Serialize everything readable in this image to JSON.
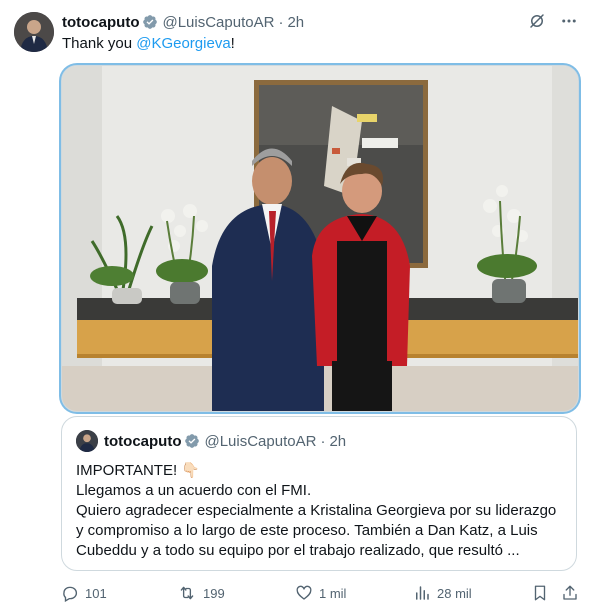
{
  "tweet": {
    "display_name": "totocaputo",
    "handle": "@LuisCaputoAR",
    "separator": "·",
    "time": "2h",
    "text_prefix": "Thank you ",
    "mention": "@KGeorgieva",
    "text_suffix": "!"
  },
  "quoted_tweet": {
    "display_name": "totocaputo",
    "handle": "@LuisCaputoAR",
    "separator": "·",
    "time": "2h",
    "lines": [
      "IMPORTANTE! 👇🏻",
      "Llegamos a un acuerdo con el FMI.",
      "Quiero agradecer especialmente a Kristalina Georgieva por su liderazgo",
      "y compromiso a lo largo de este proceso. También a Dan Katz, a Luis",
      "Cubeddu y a todo su equipo por el trabajo realizado, que resultó ..."
    ]
  },
  "actions": {
    "replies": "101",
    "reposts": "199",
    "likes": "1 mil",
    "views": "28 mil"
  },
  "colors": {
    "accent": "#1d9bf0",
    "muted": "#536471",
    "border": "#cfd9de"
  },
  "icons": [
    "verified-badge-icon",
    "grok-icon",
    "more-icon",
    "reply-icon",
    "repost-icon",
    "like-icon",
    "views-icon",
    "bookmark-icon",
    "share-icon"
  ]
}
